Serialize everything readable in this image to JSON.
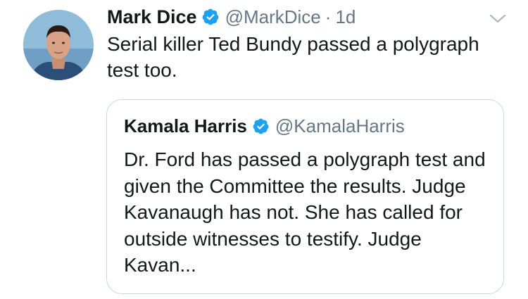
{
  "tweet": {
    "author_name": "Mark Dice",
    "author_handle": "@MarkDice",
    "separator": "·",
    "timestamp": "1d",
    "text": "Serial killer Ted Bundy passed a polygraph test too."
  },
  "quoted_tweet": {
    "author_name": "Kamala Harris",
    "author_handle": "@KamalaHarris",
    "text": "Dr. Ford has passed a polygraph test and given the Committee the results. Judge Kavanaugh has not. She has called for outside witnesses to testify. Judge Kavan..."
  },
  "icons": {
    "verified": "verified-badge-icon",
    "menu": "chevron-down-icon"
  },
  "colors": {
    "verified_blue": "#1da1f2",
    "secondary_text": "#657786",
    "primary_text": "#14171a",
    "border": "#ccd6dd"
  }
}
